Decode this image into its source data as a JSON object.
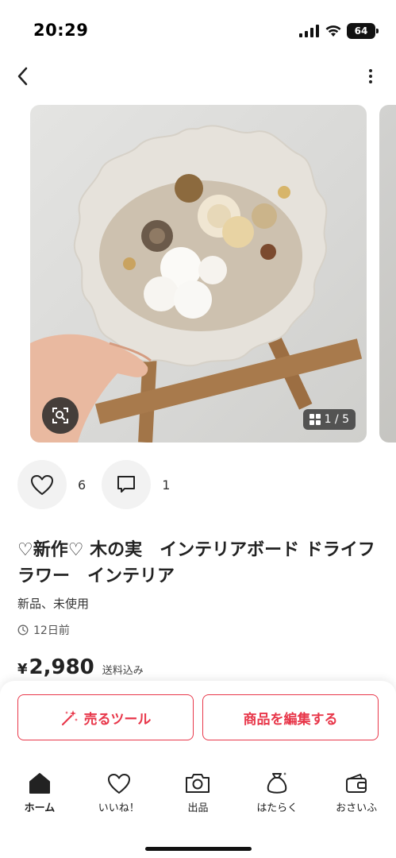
{
  "status_bar": {
    "time": "20:29",
    "battery": "64"
  },
  "photos": {
    "counter": "1 / 5"
  },
  "stats": {
    "likes": "6",
    "comments": "1"
  },
  "item": {
    "title": "♡新作♡ 木の実　インテリアボード ドライフラワー　インテリア",
    "condition": "新品、未使用",
    "posted": "12日前",
    "currency": "¥",
    "price": "2,980",
    "shipping": "送料込み"
  },
  "buttons": {
    "sell_tool": "売るツール",
    "edit_item": "商品を編集する"
  },
  "tabs": [
    {
      "label": "ホーム",
      "icon": "home-icon"
    },
    {
      "label": "いいね！",
      "icon": "heart-icon"
    },
    {
      "label": "出品",
      "icon": "camera-icon"
    },
    {
      "label": "はたらく",
      "icon": "money-bag-icon"
    },
    {
      "label": "おさいふ",
      "icon": "wallet-icon"
    }
  ],
  "colors": {
    "accent": "#e8374a",
    "text": "#222222",
    "chip_bg": "#f2f2f2"
  }
}
